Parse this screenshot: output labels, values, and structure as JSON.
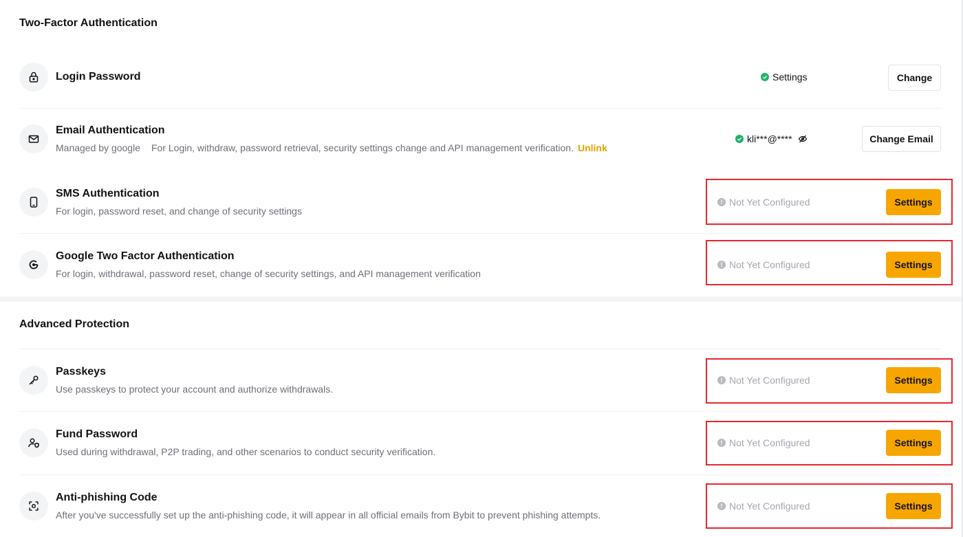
{
  "sections": {
    "two_factor": "Two-Factor Authentication",
    "advanced": "Advanced Protection"
  },
  "login_password": {
    "title": "Login Password",
    "status": "Settings",
    "button": "Change"
  },
  "email_auth": {
    "title": "Email Authentication",
    "managed": "Managed by google",
    "desc": "For Login, withdraw, password retrieval, security settings change and API management verification.",
    "unlink": "Unlink",
    "status": "kli***@****",
    "button": "Change Email"
  },
  "sms_auth": {
    "title": "SMS Authentication",
    "desc": "For login, password reset, and change of security settings",
    "status": "Not Yet Configured",
    "button": "Settings"
  },
  "google_auth": {
    "title": "Google Two Factor Authentication",
    "desc": "For login, withdrawal, password reset, change of security settings, and API management verification",
    "status": "Not Yet Configured",
    "button": "Settings"
  },
  "passkeys": {
    "title": "Passkeys",
    "desc": "Use passkeys to protect your account and authorize withdrawals.",
    "status": "Not Yet Configured",
    "button": "Settings"
  },
  "fund_password": {
    "title": "Fund Password",
    "desc": "Used during withdrawal, P2P trading, and other scenarios to conduct security verification.",
    "status": "Not Yet Configured",
    "button": "Settings"
  },
  "anti_phishing": {
    "title": "Anti-phishing Code",
    "desc": "After you've successfully set up the anti-phishing code, it will appear in all official emails from Bybit to prevent phishing attempts.",
    "status": "Not Yet Configured",
    "button": "Settings"
  },
  "icons": {
    "login_password": "lock-icon",
    "email_auth": "mail-icon",
    "sms_auth": "phone-icon",
    "google_auth": "google-authenticator-icon",
    "passkeys": "key-icon",
    "fund_password": "user-shield-icon",
    "anti_phishing": "scan-focus-icon"
  },
  "colors": {
    "accent": "#f7a600",
    "success": "#20b26c",
    "link": "#e2a400",
    "highlight_border": "#e8262c"
  }
}
